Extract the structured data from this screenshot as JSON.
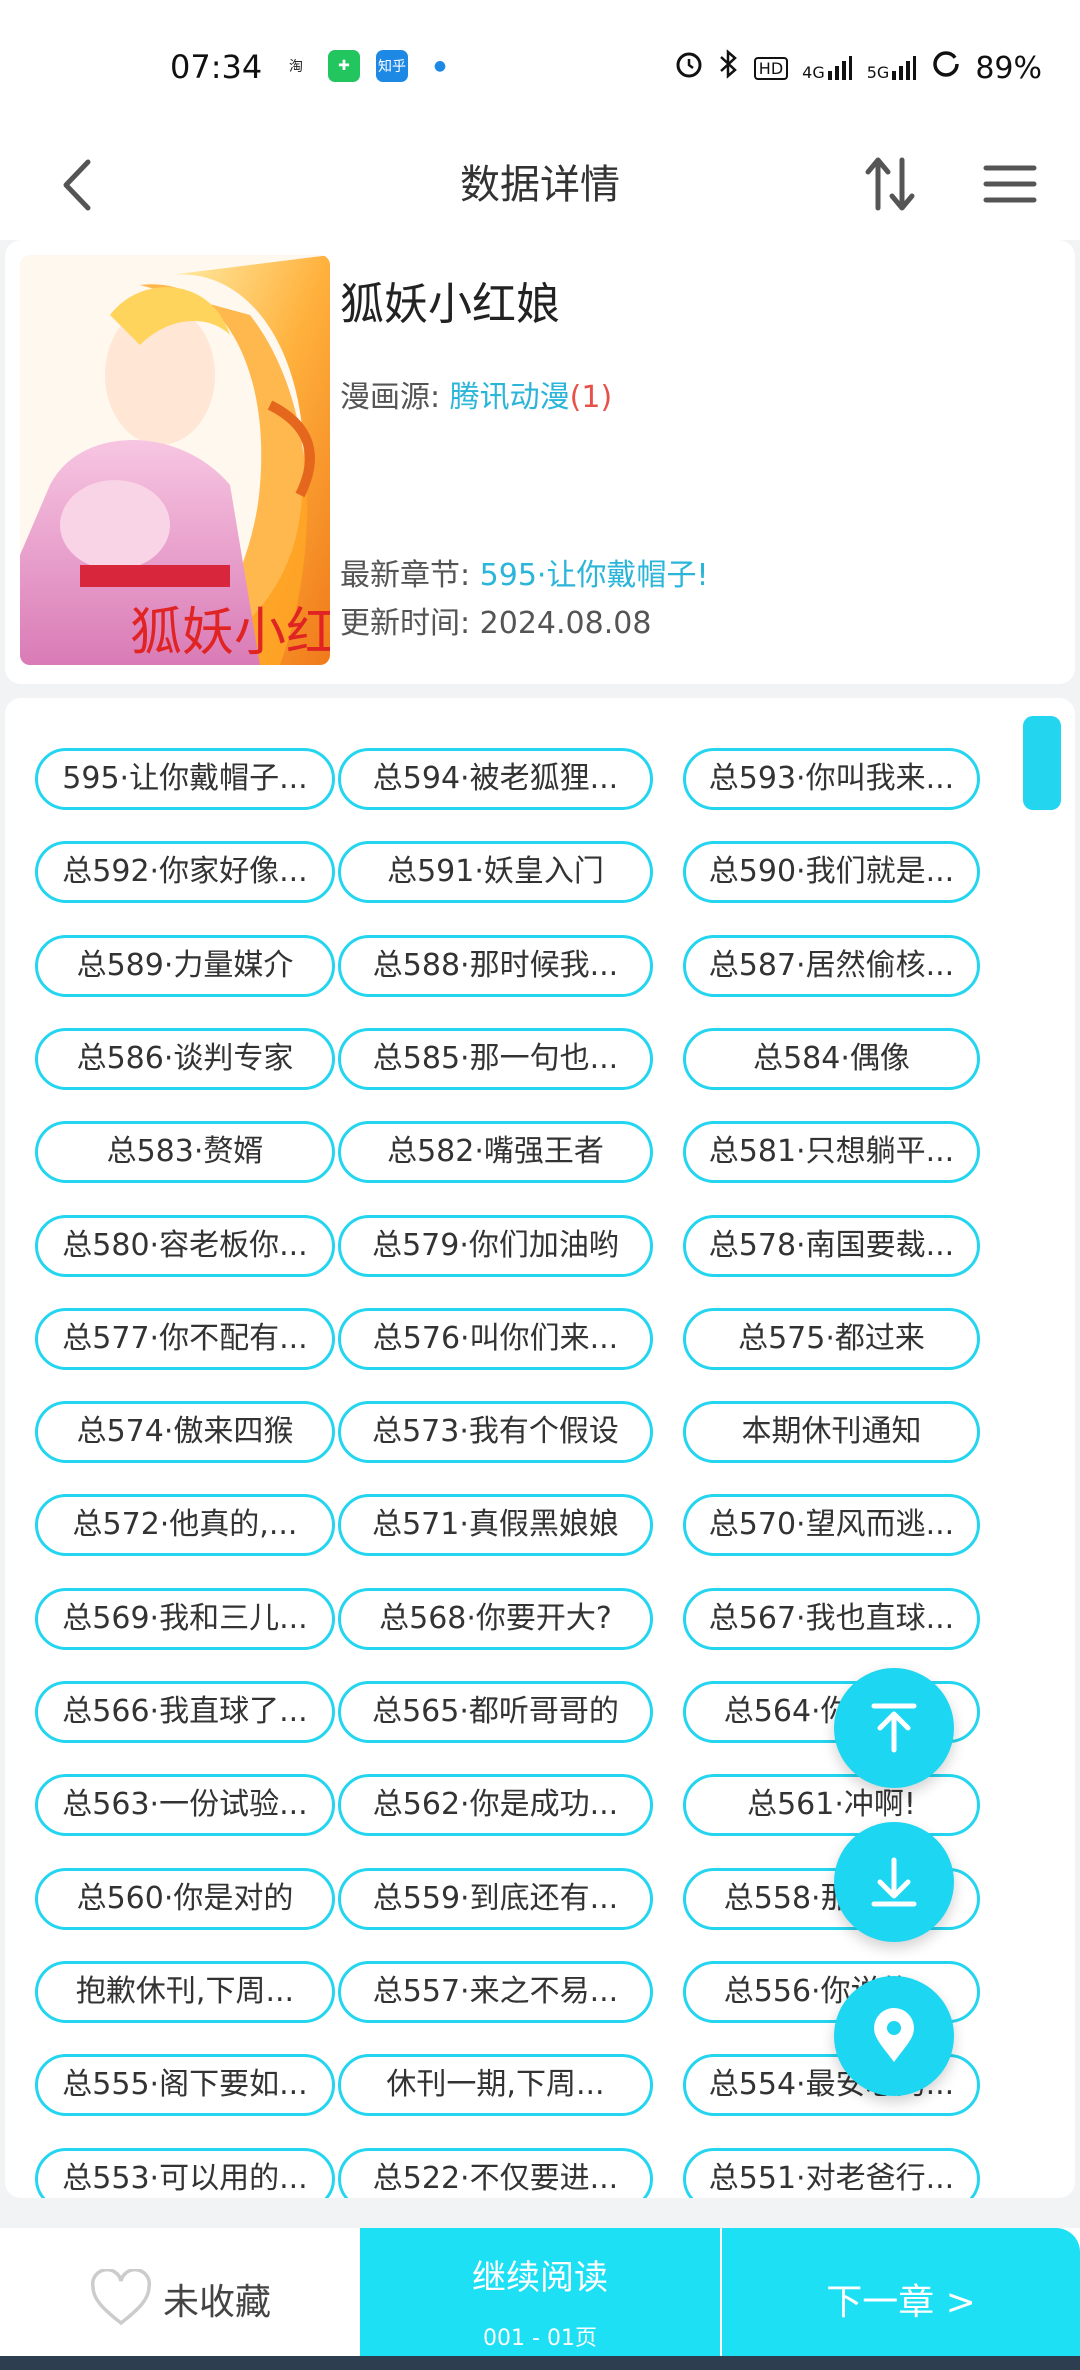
{
  "status_bar": {
    "time": "07:34",
    "app_icons": [
      {
        "name": "taobao-icon",
        "label": "淘",
        "color": "#ffffff",
        "text_color": "#222"
      },
      {
        "name": "shield-app-icon",
        "label": "✚",
        "color": "#22c55e",
        "text_color": "#fff"
      },
      {
        "name": "zhihu-icon",
        "label": "知乎",
        "color": "#1e88e5",
        "text_color": "#fff"
      },
      {
        "name": "message-app-icon",
        "label": "●",
        "color": "#ffffff",
        "text_color": "#1e88e5"
      }
    ],
    "battery": "89%",
    "network_labels": [
      "4G",
      "5G"
    ],
    "hd_label": "HD"
  },
  "header": {
    "title": "数据详情"
  },
  "manga": {
    "title": "狐妖小红娘",
    "source_label": "漫画源:",
    "source_name": "腾讯动漫",
    "source_count": "(1)",
    "latest_label": "最新章节:",
    "latest_chapter": "595·让你戴帽子!",
    "update_label": "更新时间:",
    "update_time": "2024.08.08",
    "cover_text": "狐妖小红娘"
  },
  "chapters": [
    "595·让你戴帽子...",
    "总594·被老狐狸...",
    "总593·你叫我来...",
    "总592·你家好像...",
    "总591·妖皇入门",
    "总590·我们就是...",
    "总589·力量媒介",
    "总588·那时候我...",
    "总587·居然偷核...",
    "总586·谈判专家",
    "总585·那一句也...",
    "总584·偶像",
    "总583·赘婿",
    "总582·嘴强王者",
    "总581·只想躺平...",
    "总580·容老板你...",
    "总579·你们加油哟",
    "总578·南国要裁...",
    "总577·你不配有...",
    "总576·叫你们来...",
    "总575·都过来",
    "总574·傲来四猴",
    "总573·我有个假设",
    "本期休刊通知",
    "总572·他真的,...",
    "总571·真假黑娘娘",
    "总570·望风而逃...",
    "总569·我和三儿...",
    "总568·你要开大?",
    "总567·我也直球...",
    "总566·我直球了...",
    "总565·都听哥哥的",
    "总564·你哥哥...",
    "总563·一份试验...",
    "总562·你是成功...",
    "总561·冲啊!",
    "总560·你是对的",
    "总559·到底还有...",
    "总558·那么熟...",
    "抱歉休刊,下周...",
    "总557·来之不易...",
    "总556·你说的...",
    "总555·阁下要如...",
    "休刊一期,下周...",
    "总554·最安心的...",
    "总553·可以用的...",
    "总522·不仅要进...",
    "总551·对老爸行..."
  ],
  "floating": {
    "top_icon": "scroll-to-top-icon",
    "bottom_icon": "scroll-to-bottom-icon",
    "locate_icon": "location-pin-icon"
  },
  "bottom_bar": {
    "favorite_label": "未收藏",
    "continue_label": "继续阅读",
    "continue_progress": "001 - 01页",
    "next_label": "下一章 >"
  },
  "colors": {
    "accent": "#1dd6f2",
    "link": "#2bb5d8",
    "count_red": "#e8504a"
  }
}
